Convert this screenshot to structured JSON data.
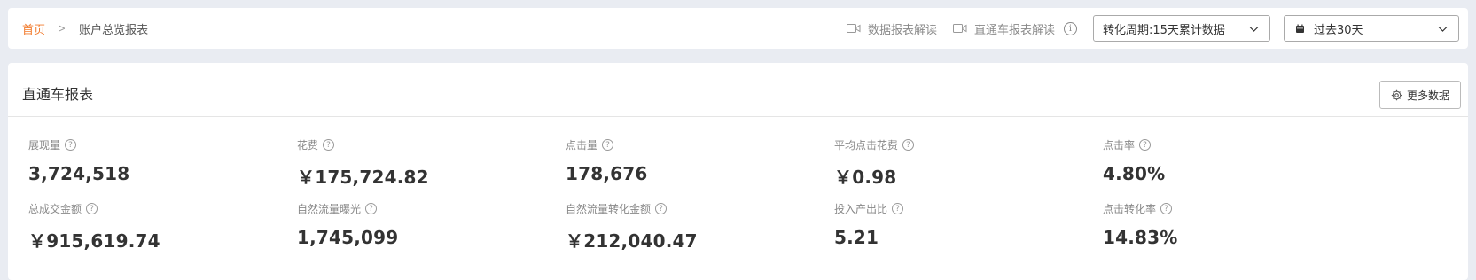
{
  "breadcrumb": {
    "home": "首页",
    "separator": ">",
    "current": "账户总览报表"
  },
  "toolbar": {
    "data_guide": "数据报表解读",
    "through_train_guide": "直通车报表解读",
    "info_icon": "i",
    "period_select": "转化周期:15天累计数据",
    "date_select": "过去30天"
  },
  "report": {
    "title": "直通车报表",
    "more_button": "更多数据",
    "help_icon": "?",
    "metrics": [
      {
        "label": "展现量",
        "value": "3,724,518"
      },
      {
        "label": "花费",
        "value": "￥175,724.82"
      },
      {
        "label": "点击量",
        "value": "178,676"
      },
      {
        "label": "平均点击花费",
        "value": "￥0.98"
      },
      {
        "label": "点击率",
        "value": "4.80%"
      },
      {
        "label": "总成交金额",
        "value": "￥915,619.74"
      },
      {
        "label": "自然流量曝光",
        "value": "1,745,099"
      },
      {
        "label": "自然流量转化金额",
        "value": "￥212,040.47"
      },
      {
        "label": "投入产出比",
        "value": "5.21"
      },
      {
        "label": "点击转化率",
        "value": "14.83%"
      }
    ]
  },
  "colors": {
    "accent": "#f27b2d",
    "background": "#e9ecf2"
  },
  "icons": [
    "video-icon",
    "info-icon",
    "chevron-down-icon",
    "calendar-icon",
    "gear-icon",
    "help-icon"
  ]
}
